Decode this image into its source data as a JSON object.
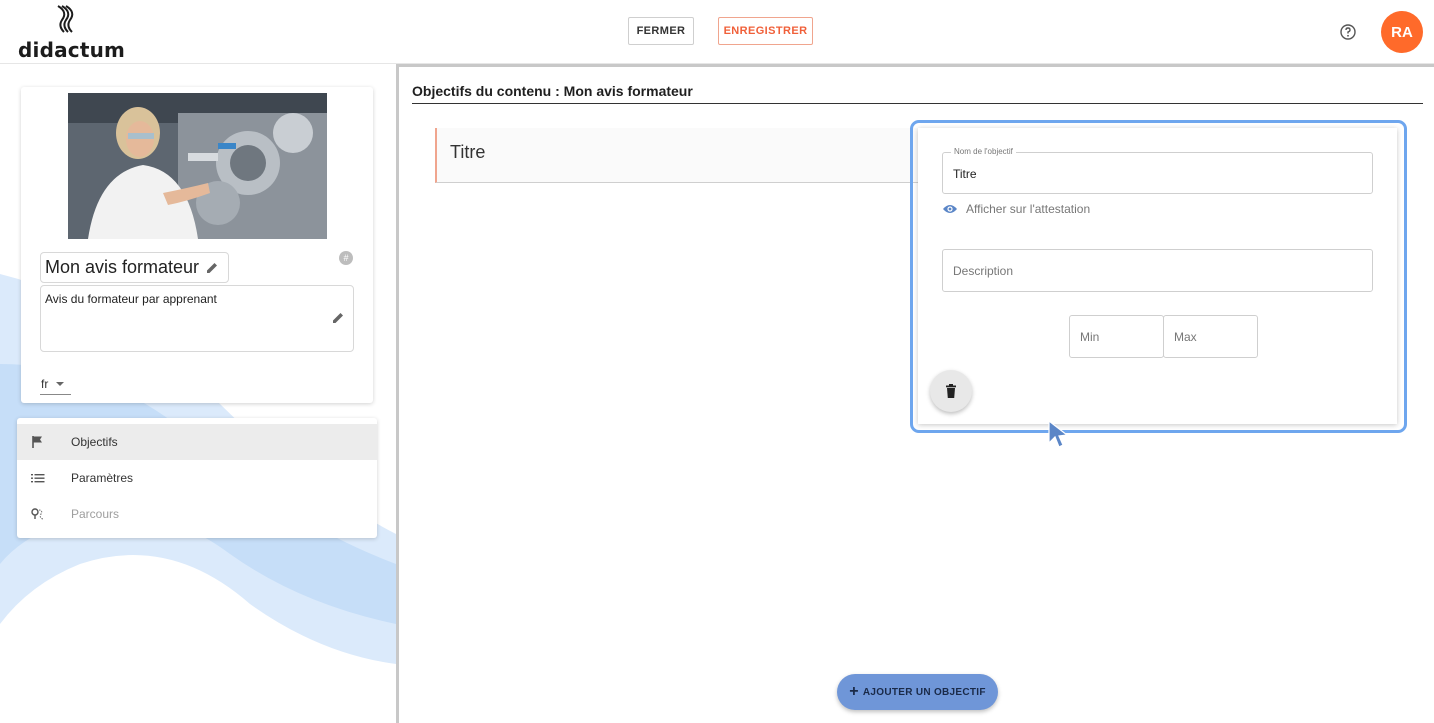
{
  "header": {
    "logo_text": "didactum",
    "close_label": "FERMER",
    "save_label": "ENREGISTRER",
    "help_icon": "help-circle-icon",
    "avatar_initials": "RA"
  },
  "content_card": {
    "title": "Mon avis formateur",
    "description": "Avis du formateur par apprenant",
    "language": "fr",
    "hash_badge": "#"
  },
  "nav": {
    "items": [
      {
        "label": "Objectifs",
        "icon": "flag-icon",
        "state": "active"
      },
      {
        "label": "Paramètres",
        "icon": "list-icon",
        "state": "normal"
      },
      {
        "label": "Parcours",
        "icon": "route-icon",
        "state": "disabled"
      }
    ]
  },
  "main": {
    "title": "Objectifs du contenu : Mon avis formateur",
    "objective_row_title": "Titre",
    "add_button_label": "AJOUTER UN OBJECTIF"
  },
  "objective_editor": {
    "name_legend": "Nom de l'objectif",
    "name_value": "Titre",
    "show_on_certificate": "Afficher sur l'attestation",
    "description_placeholder": "Description",
    "min_placeholder": "Min",
    "max_placeholder": "Max"
  },
  "colors": {
    "accent_orange": "#ff6a2a",
    "focus_blue": "#6ea6ee",
    "fab_blue": "#6f96d8"
  }
}
